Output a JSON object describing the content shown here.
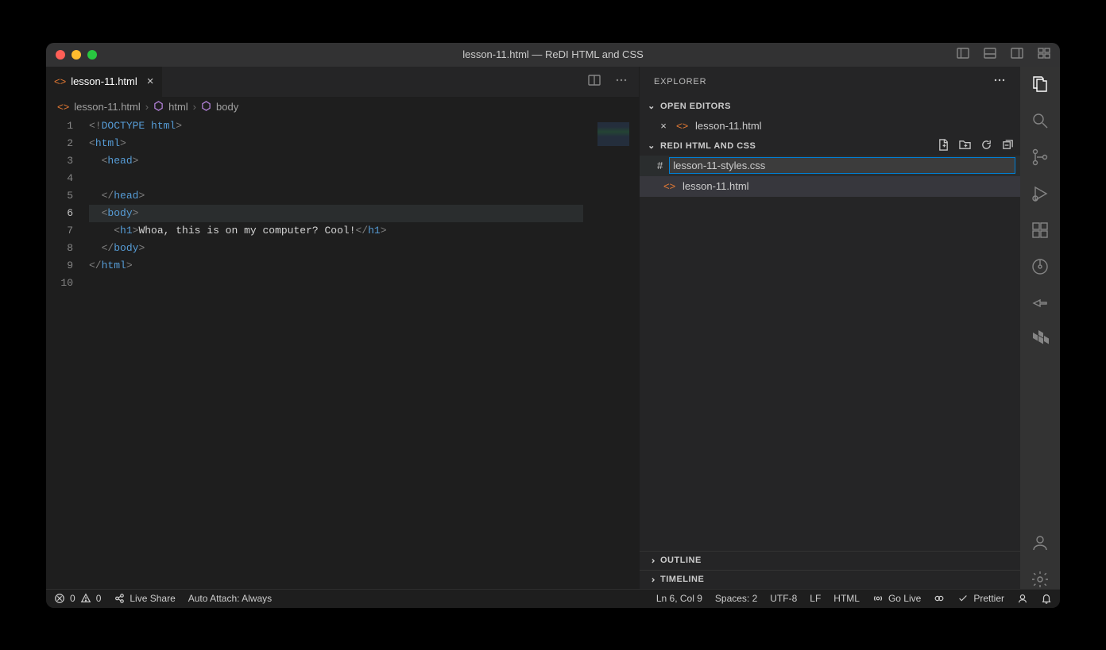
{
  "window": {
    "title": "lesson-11.html — ReDI HTML and CSS"
  },
  "tabs": {
    "active": {
      "name": "lesson-11.html"
    }
  },
  "breadcrumbs": {
    "file": "lesson-11.html",
    "path1": "html",
    "path2": "body"
  },
  "code": {
    "lines": [
      {
        "n": 1,
        "html": "<span class='tok-bracket'>&lt;!</span><span class='tok-doctype'>DOCTYPE</span> <span class='tok-tag'>html</span><span class='tok-bracket'>&gt;</span>"
      },
      {
        "n": 2,
        "html": "<span class='tok-bracket'>&lt;</span><span class='tok-tag'>html</span><span class='tok-bracket'>&gt;</span>"
      },
      {
        "n": 3,
        "html": "  <span class='tok-bracket'>&lt;</span><span class='tok-tag'>head</span><span class='tok-bracket'>&gt;</span>"
      },
      {
        "n": 4,
        "html": ""
      },
      {
        "n": 5,
        "html": "  <span class='tok-bracket'>&lt;/</span><span class='tok-tag'>head</span><span class='tok-bracket'>&gt;</span>"
      },
      {
        "n": 6,
        "html": "  <span class='tok-bracket'>&lt;</span><span class='tok-tag'>body</span><span class='tok-bracket'>&gt;</span>",
        "active": true
      },
      {
        "n": 7,
        "html": "    <span class='tok-bracket'>&lt;</span><span class='tok-tag'>h1</span><span class='tok-bracket'>&gt;</span><span class='tok-text'>Whoa, this is on my computer? Cool!</span><span class='tok-bracket'>&lt;/</span><span class='tok-tag'>h1</span><span class='tok-bracket'>&gt;</span>"
      },
      {
        "n": 8,
        "html": "  <span class='tok-bracket'>&lt;/</span><span class='tok-tag'>body</span><span class='tok-bracket'>&gt;</span>"
      },
      {
        "n": 9,
        "html": "<span class='tok-bracket'>&lt;/</span><span class='tok-tag'>html</span><span class='tok-bracket'>&gt;</span>"
      },
      {
        "n": 10,
        "html": ""
      }
    ]
  },
  "explorer": {
    "title": "EXPLORER",
    "openEditors": {
      "label": "OPEN EDITORS",
      "items": [
        {
          "name": "lesson-11.html"
        }
      ]
    },
    "workspace": {
      "label": "REDI HTML AND CSS",
      "newFile": "lesson-11-styles.css",
      "files": [
        {
          "name": "lesson-11.html"
        }
      ]
    },
    "outline": "OUTLINE",
    "timeline": "TIMELINE"
  },
  "statusBar": {
    "errors": "0",
    "warnings": "0",
    "liveShare": "Live Share",
    "autoAttach": "Auto Attach: Always",
    "position": "Ln 6, Col 9",
    "spaces": "Spaces: 2",
    "encoding": "UTF-8",
    "eol": "LF",
    "language": "HTML",
    "goLive": "Go Live",
    "prettier": "Prettier"
  }
}
